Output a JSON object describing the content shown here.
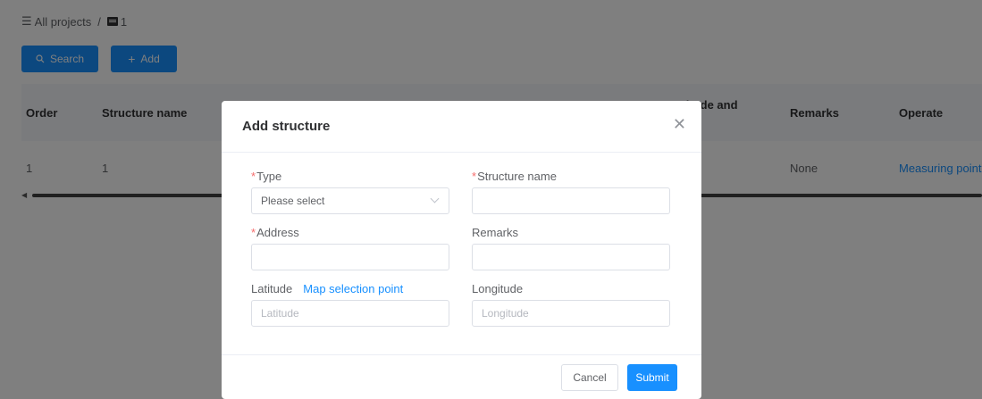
{
  "breadcrumb": {
    "root_icon": "list-icon",
    "root_label": "All projects",
    "separator": "/",
    "current_icon": "folder-icon",
    "current_label": "1"
  },
  "toolbar": {
    "search_icon": "search-icon",
    "search_label": "Search",
    "add_icon": "plus-icon",
    "add_label": "Add"
  },
  "table": {
    "columns": {
      "order": "Order",
      "structure_name": "Structure name",
      "long_lat": "Longitude and latitude",
      "remarks": "Remarks",
      "operate": "Operate"
    },
    "rows": [
      {
        "order": "1",
        "structure_name": "1",
        "long_lat": "",
        "remarks": "None",
        "operate": "Measuring point"
      }
    ]
  },
  "dialog": {
    "title": "Add structure",
    "close_icon": "close-icon",
    "fields": {
      "type": {
        "label": "Type",
        "required": "*",
        "placeholder": "Please select"
      },
      "structure_name": {
        "label": "Structure name",
        "required": "*",
        "value": ""
      },
      "address": {
        "label": "Address",
        "required": "*",
        "value": ""
      },
      "remarks": {
        "label": "Remarks",
        "value": ""
      },
      "latitude": {
        "label": "Latitude",
        "link": "Map selection point",
        "placeholder": "Latitude"
      },
      "longitude": {
        "label": "Longitude",
        "placeholder": "Longitude"
      }
    },
    "cancel_label": "Cancel",
    "submit_label": "Submit"
  },
  "colors": {
    "primary": "#1890ff",
    "required": "#f56c6c",
    "overlay": "rgba(0,0,0,0.5)"
  }
}
